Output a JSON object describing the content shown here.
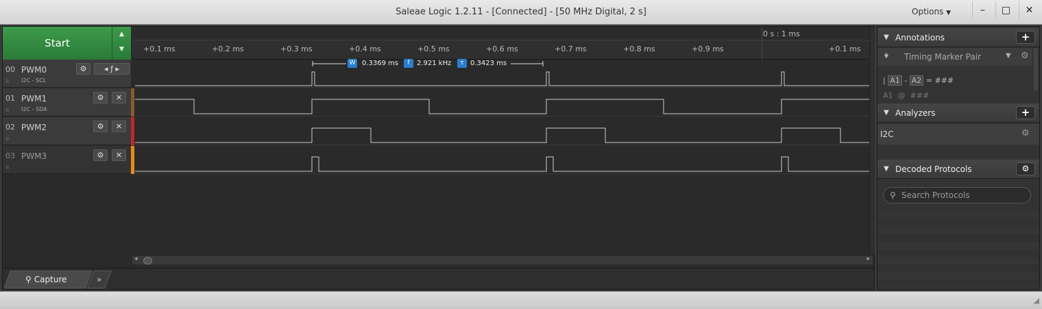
{
  "window": {
    "title": "Saleae Logic 1.2.11 - [Connected] - [50 MHz Digital, 2 s]",
    "options_label": "Options",
    "minimize": "–",
    "maximize": "□",
    "close": "✕"
  },
  "start": {
    "label": "Start"
  },
  "ruler": {
    "origin": "0 s : 1 ms",
    "ticks": [
      "+0.1 ms",
      "+0.2 ms",
      "+0.3 ms",
      "+0.4 ms",
      "+0.5 ms",
      "+0.6 ms",
      "+0.7 ms",
      "+0.8 ms",
      "+0.9 ms",
      "+0.1 ms"
    ]
  },
  "marker": {
    "width_value": "0.3369 ms",
    "freq_value": "2.921 kHz",
    "tau_value": "0.3423 ms",
    "width_badge": "W",
    "freq_badge": "f",
    "tau_badge": "τ"
  },
  "channels": [
    {
      "num": "00",
      "name": "PWM0",
      "sub": "I2C - SCL",
      "color": "#2a2a2a"
    },
    {
      "num": "01",
      "name": "PWM1",
      "sub": "I2C - SDA",
      "color": "#8b5a2b"
    },
    {
      "num": "02",
      "name": "PWM2",
      "sub": "",
      "color": "#c0282b"
    },
    {
      "num": "03",
      "name": "PWM3",
      "sub": "",
      "color": "#e88a1a"
    }
  ],
  "tabs": {
    "capture": "Capture",
    "more": "»"
  },
  "annotations": {
    "header": "Annotations",
    "item": "Timing Marker Pair",
    "line1_a1": "A1",
    "line1_sep": "-",
    "line1_a2": "A2",
    "line1_eq": "= ###",
    "line2": "A1  @  ###"
  },
  "analyzers": {
    "header": "Analyzers",
    "item": "I2C"
  },
  "decoded": {
    "header": "Decoded Protocols",
    "search_placeholder": "Search Protocols"
  }
}
